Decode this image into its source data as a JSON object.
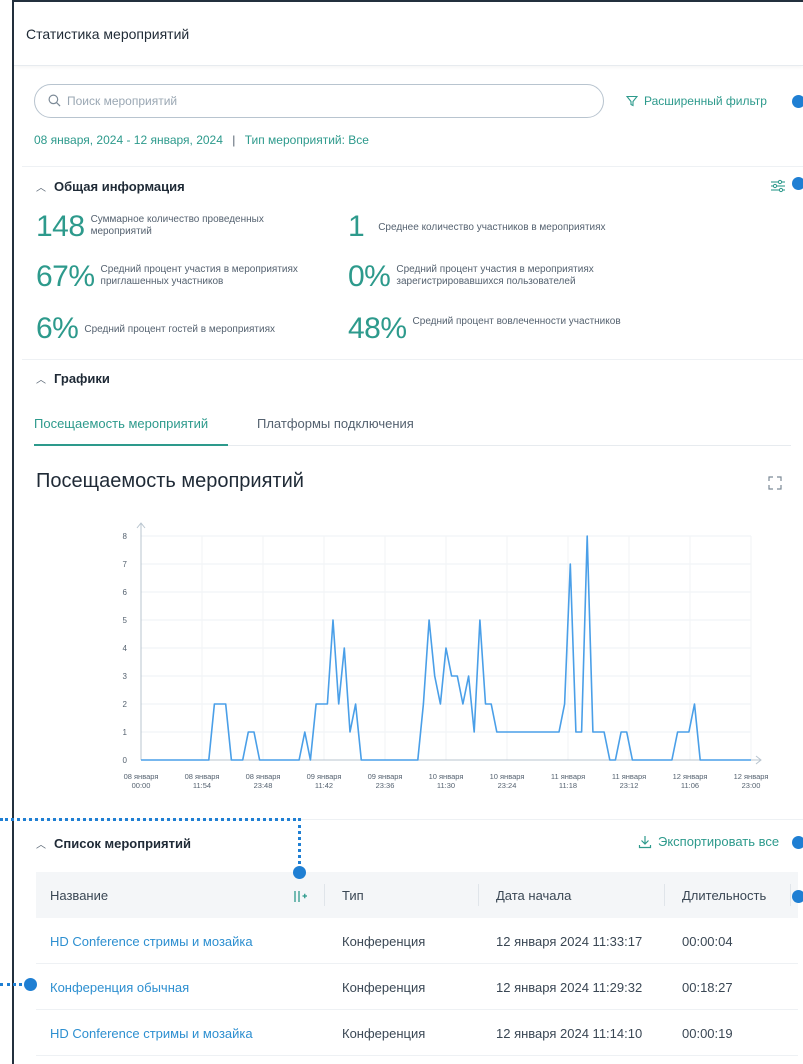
{
  "header": {
    "title": "Статистика мероприятий"
  },
  "search": {
    "placeholder": "Поиск мероприятий",
    "value": ""
  },
  "filter": {
    "advanced_label": "Расширенный фильтр",
    "date_range": "08 января, 2024 - 12 января, 2024",
    "separator": "|",
    "type_label": "Тип мероприятий: Все"
  },
  "general": {
    "title": "Общая информация",
    "stats": [
      {
        "value": "148",
        "label": "Суммарное количество проведенных мероприятий"
      },
      {
        "value": "1",
        "label": "Среднее количество участников в мероприятиях"
      },
      {
        "value": "67%",
        "label": "Средний процент участия в мероприятиях приглашенных участников"
      },
      {
        "value": "0%",
        "label": "Средний процент участия в мероприятиях зарегистрировавшихся пользователей"
      },
      {
        "value": "6%",
        "label": "Средний процент гостей в мероприятиях"
      },
      {
        "value": "48%",
        "label": "Средний процент вовлеченности участников"
      }
    ]
  },
  "charts": {
    "title": "Графики",
    "tabs": [
      {
        "label": "Посещаемость мероприятий",
        "active": true
      },
      {
        "label": "Платформы подключения",
        "active": false
      }
    ],
    "chart_title": "Посещаемость мероприятий"
  },
  "chart_data": {
    "type": "line",
    "title": "Посещаемость мероприятий",
    "xlabel": "",
    "ylabel": "",
    "ylim": [
      0,
      8
    ],
    "yticks": [
      0,
      1,
      2,
      3,
      4,
      5,
      6,
      7,
      8
    ],
    "xtick_labels": [
      [
        "08 января",
        "00:00"
      ],
      [
        "08 января",
        "11:54"
      ],
      [
        "08 января",
        "23:48"
      ],
      [
        "09 января",
        "11:42"
      ],
      [
        "09 января",
        "23:36"
      ],
      [
        "10 января",
        "11:30"
      ],
      [
        "10 января",
        "23:24"
      ],
      [
        "11 января",
        "11:18"
      ],
      [
        "11 января",
        "23:12"
      ],
      [
        "12 января",
        "11:06"
      ],
      [
        "12 января",
        "23:00"
      ]
    ],
    "series_color": "#4a9fe8",
    "grid": true,
    "series": [
      {
        "values": [
          0,
          0,
          0,
          0,
          0,
          0,
          0,
          0,
          0,
          0,
          0,
          0,
          0,
          2,
          2,
          2,
          0,
          0,
          0,
          1,
          1,
          0,
          0,
          0,
          0,
          0,
          0,
          0,
          0,
          1,
          0,
          2,
          2,
          2,
          5,
          2,
          4,
          1,
          2,
          0,
          0,
          0,
          0,
          0,
          0,
          0,
          0,
          0,
          0,
          0,
          2,
          5,
          3,
          2,
          4,
          3,
          3,
          2,
          3,
          1,
          5,
          2,
          2,
          1,
          1,
          1,
          1,
          1,
          1,
          1,
          1,
          1,
          1,
          1,
          1,
          2,
          7,
          1,
          1,
          8,
          1,
          1,
          1,
          0,
          0,
          1,
          1,
          0,
          0,
          0,
          0,
          0,
          0,
          0,
          0,
          1,
          1,
          1,
          2,
          0,
          0,
          0,
          0,
          0,
          0,
          0,
          0,
          0,
          0
        ]
      }
    ]
  },
  "events_list": {
    "title": "Список мероприятий",
    "export_label": "Экспортировать все",
    "columns": [
      "Название",
      "Тип",
      "Дата начала",
      "Длительность"
    ],
    "rows": [
      [
        "HD Conference стримы и мозайка",
        "Конференция",
        "12 января 2024 11:33:17",
        "00:00:04"
      ],
      [
        "Конференция обычная",
        "Конференция",
        "12 января 2024 11:29:32",
        "00:18:27"
      ],
      [
        "HD Conference стримы и мозайка",
        "Конференция",
        "12 января 2024 11:14:10",
        "00:00:19"
      ]
    ]
  },
  "colors": {
    "accent": "#2d9a8c",
    "link": "#2d8fd0",
    "annotation": "#1f7fd3",
    "line": "#4a9fe8"
  }
}
